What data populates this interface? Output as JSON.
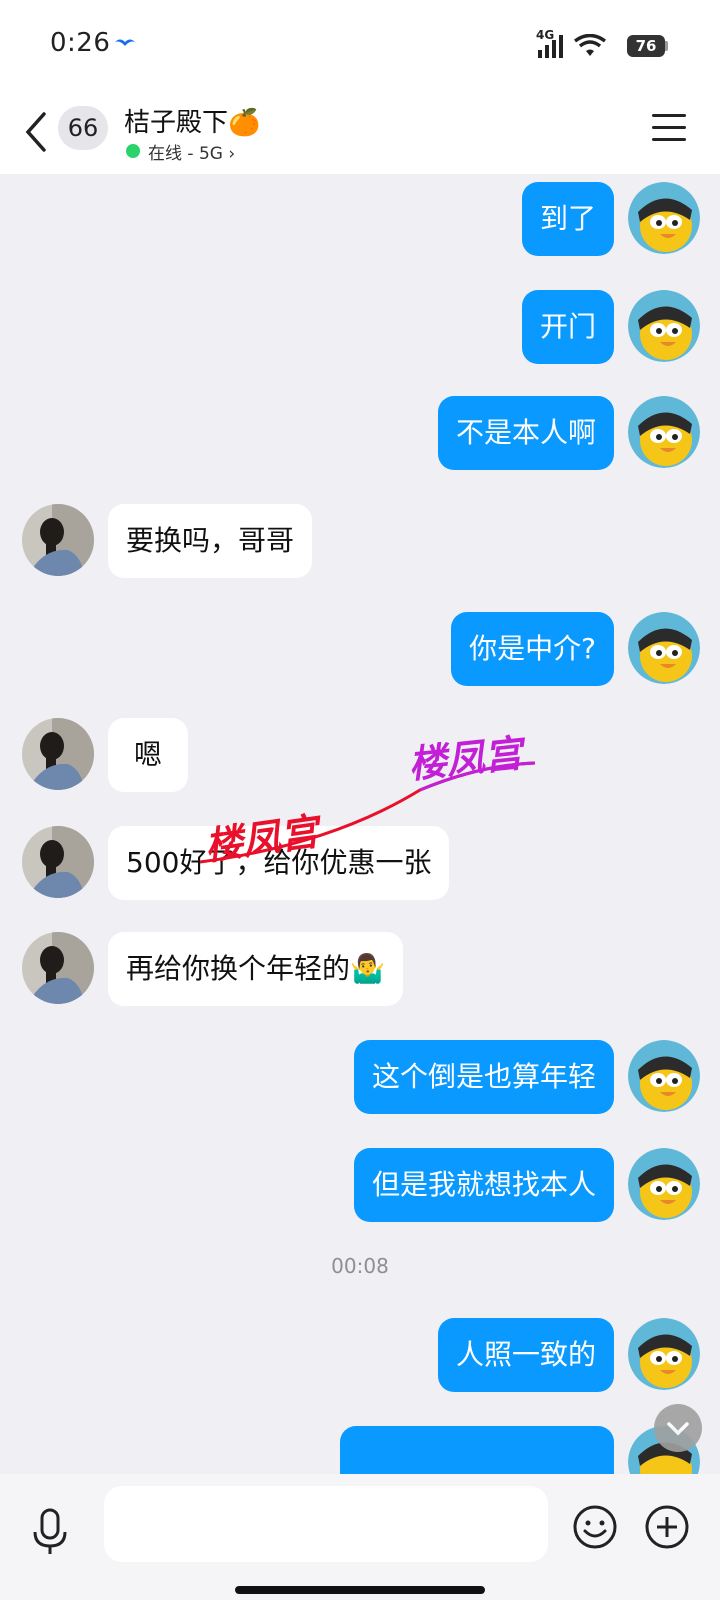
{
  "status_bar": {
    "time": "0:26",
    "network": "4G",
    "battery": "76"
  },
  "header": {
    "unread_count": "66",
    "contact_name": "桔子殿下🍊",
    "status": "在线 - 5G",
    "status_chevron": "›"
  },
  "messages": [
    {
      "side": "out",
      "text": "到了"
    },
    {
      "side": "out",
      "text": "开门"
    },
    {
      "side": "out",
      "text": "不是本人啊"
    },
    {
      "side": "in",
      "text": "要换吗，哥哥"
    },
    {
      "side": "out",
      "text": "你是中介?"
    },
    {
      "side": "in",
      "text": "嗯"
    },
    {
      "side": "in",
      "text": "500好了，给你优惠一张"
    },
    {
      "side": "in",
      "text": "再给你换个年轻的🤷‍♂️"
    },
    {
      "side": "out",
      "text": "这个倒是也算年轻"
    },
    {
      "side": "out",
      "text": "但是我就想找本人"
    },
    {
      "side": "out",
      "text": "人照一致的"
    },
    {
      "side": "out",
      "text": ""
    }
  ],
  "timestamp": "00:08",
  "watermarks": [
    "楼凤宫",
    "楼凤宫"
  ],
  "colors": {
    "outgoing_bubble": "#0a99ff",
    "incoming_bubble": "#ffffff",
    "chat_background": "#efeff4",
    "online_dot": "#2bd36b",
    "watermark_red": "#e8102a",
    "watermark_purple": "#c21fd6"
  }
}
